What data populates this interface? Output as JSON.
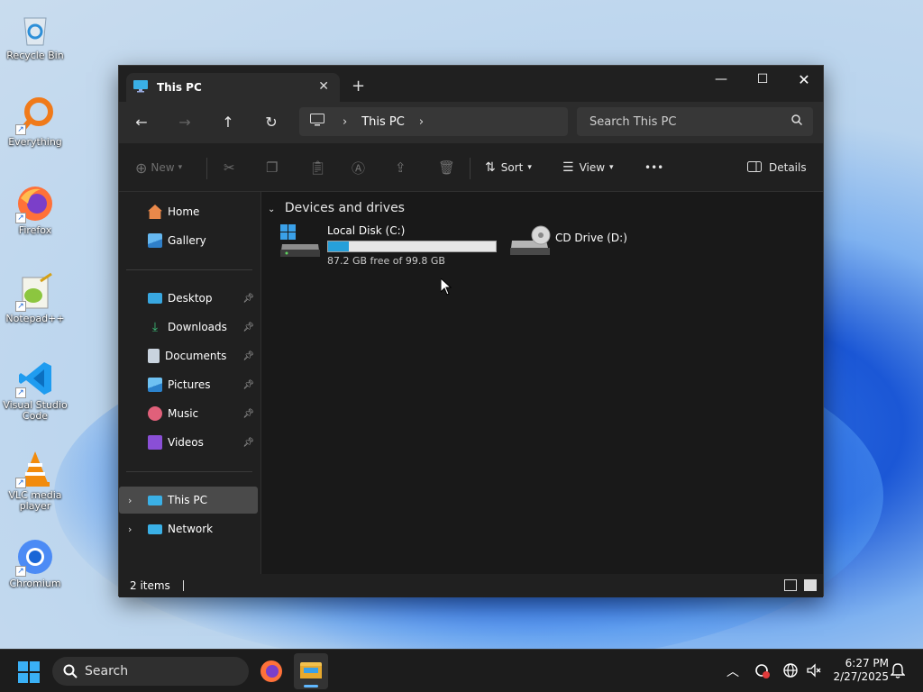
{
  "desktop": {
    "icons": [
      {
        "label": "Recycle Bin",
        "icon": "recycle-bin-icon"
      },
      {
        "label": "Everything",
        "icon": "everything-icon"
      },
      {
        "label": "Firefox",
        "icon": "firefox-icon"
      },
      {
        "label": "Notepad++",
        "icon": "notepad-plus-plus-icon"
      },
      {
        "label": "Visual Studio Code",
        "icon": "vscode-icon"
      },
      {
        "label": "VLC media player",
        "icon": "vlc-icon"
      },
      {
        "label": "Chromium",
        "icon": "chromium-icon"
      }
    ]
  },
  "window": {
    "tab_title": "This PC",
    "close_tab": "✕",
    "new_tab": "+",
    "controls": {
      "minimize": "—",
      "maximize": "☐",
      "close": "✕"
    },
    "address": {
      "location": "This PC",
      "separator": "›"
    },
    "search_placeholder": "Search This PC",
    "toolbar": {
      "new_label": "New",
      "sort_label": "Sort",
      "view_label": "View",
      "more_label": "•••",
      "details_label": "Details"
    },
    "nav": {
      "quick": [
        {
          "label": "Home"
        },
        {
          "label": "Gallery"
        }
      ],
      "pinned": [
        {
          "label": "Desktop"
        },
        {
          "label": "Downloads"
        },
        {
          "label": "Documents"
        },
        {
          "label": "Pictures"
        },
        {
          "label": "Music"
        },
        {
          "label": "Videos"
        }
      ],
      "tree": [
        {
          "label": "This PC"
        },
        {
          "label": "Network"
        }
      ]
    },
    "content": {
      "group_title": "Devices and drives",
      "drives": [
        {
          "name": "Local Disk (C:)",
          "free_text": "87.2 GB free of 99.8 GB",
          "used_fraction": 0.126
        },
        {
          "name": "CD Drive (D:)"
        }
      ]
    },
    "status": {
      "items": "2 items"
    }
  },
  "taskbar": {
    "search_label": "Search",
    "time": "6:27 PM",
    "date": "2/27/2025"
  },
  "colors": {
    "accent": "#26a0da",
    "window_bg": "#191919",
    "taskbar_bg": "#1c1c1c"
  }
}
